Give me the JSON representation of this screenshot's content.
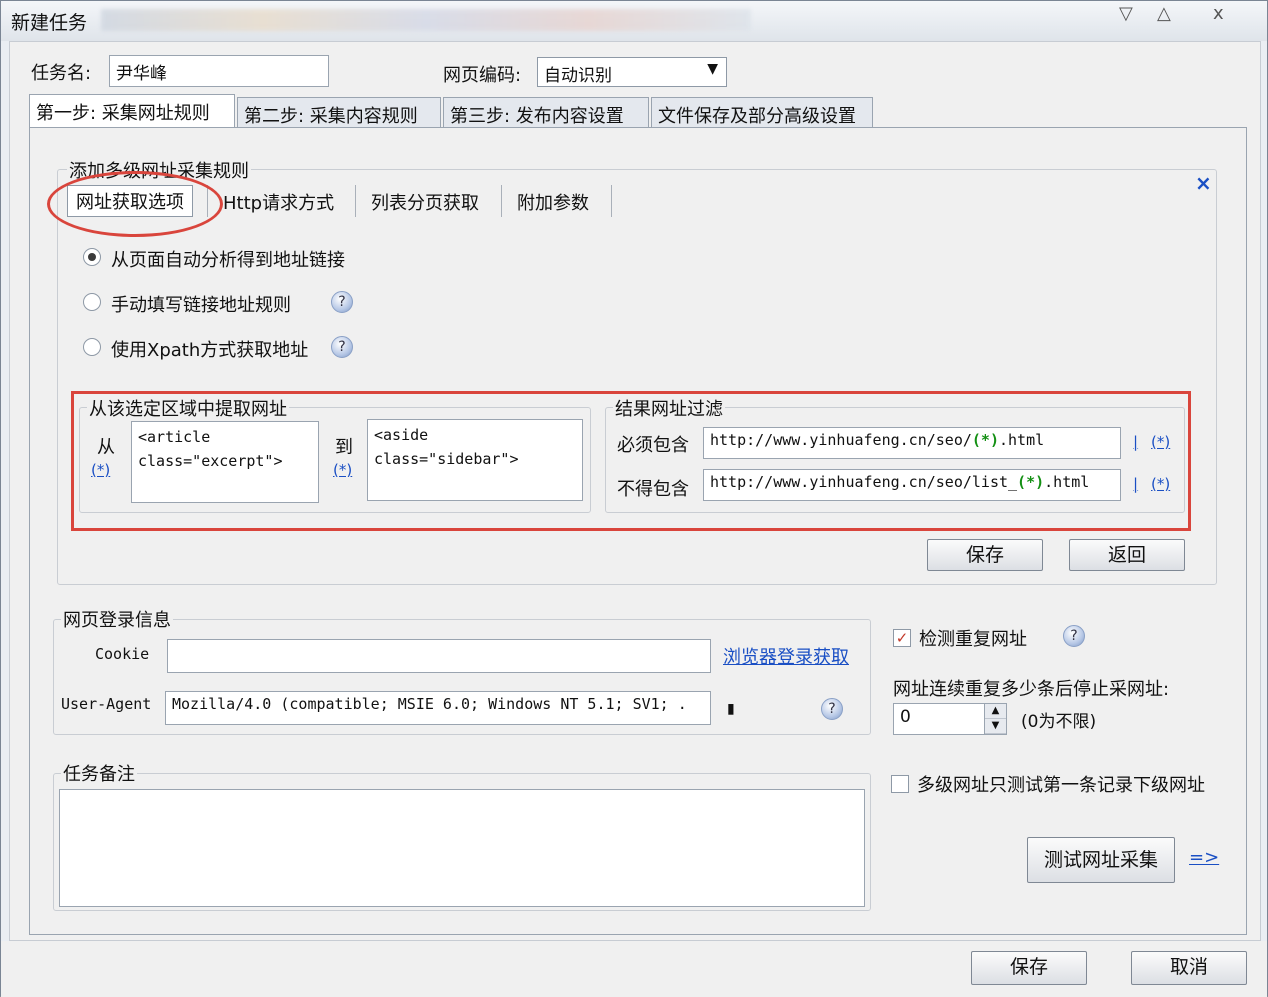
{
  "window": {
    "title": "新建任务",
    "controls": [
      "▽",
      "△",
      "ⅹ"
    ]
  },
  "header": {
    "task_name_label": "任务名:",
    "task_name_value": "尹华峰",
    "encoding_label": "网页编码:",
    "encoding_value": "自动识别"
  },
  "tabs": [
    {
      "label": "第一步: 采集网址规则"
    },
    {
      "label": "第二步: 采集内容规则"
    },
    {
      "label": "第三步: 发布内容设置"
    },
    {
      "label": "文件保存及部分高级设置"
    }
  ],
  "rule_group": {
    "title": "添加多级网址采集规则",
    "close": "×",
    "subtabs": [
      "网址获取选项",
      "Http请求方式",
      "列表分页获取",
      "附加参数"
    ],
    "radios": [
      {
        "label": "从页面自动分析得到地址链接",
        "checked": true,
        "help": false
      },
      {
        "label": "手动填写链接地址规则",
        "checked": false,
        "help": true
      },
      {
        "label": "使用Xpath方式获取地址",
        "checked": false,
        "help": true
      }
    ],
    "extract": {
      "title": "从该选定区域中提取网址",
      "from_label": "从",
      "from_star": "(*)",
      "from_value_line1": "<article",
      "from_value_line2": "class=\"excerpt\">",
      "to_label": "到",
      "to_star": "(*)",
      "to_value_line1": "<aside",
      "to_value_line2": "class=\"sidebar\">"
    },
    "filter": {
      "title": "结果网址过滤",
      "must_label": "必须包含",
      "must_value_prefix": "http://www.yinhuafeng.cn/seo/",
      "must_value_token": "(*)",
      "must_value_suffix": ".html",
      "mustnot_label": "不得包含",
      "mustnot_value_prefix": "http://www.yinhuafeng.cn/seo/list_",
      "mustnot_value_token": "(*)",
      "mustnot_value_suffix": ".html",
      "pipe": "|",
      "star": "(*)"
    },
    "save_button": "保存",
    "back_button": "返回"
  },
  "login": {
    "title": "网页登录信息",
    "cookie_label": "Cookie",
    "cookie_value": "",
    "browser_login_link": "浏览器登录获取",
    "ua_label": "User-Agent",
    "ua_value": "Mozilla/4.0 (compatible; MSIE 6.0; Windows NT 5.1; SV1; ."
  },
  "notes": {
    "title": "任务备注",
    "value": ""
  },
  "right": {
    "dup_check_label": "检测重复网址",
    "dup_checked": true,
    "stop_label": "网址连续重复多少条后停止采网址:",
    "stop_value": "0",
    "stop_hint": "(0为不限)",
    "multilevel_label": "多级网址只测试第一条记录下级网址",
    "multilevel_checked": false,
    "test_button": "测试网址采集",
    "test_link": "=>"
  },
  "footer": {
    "save": "保存",
    "cancel": "取消"
  }
}
